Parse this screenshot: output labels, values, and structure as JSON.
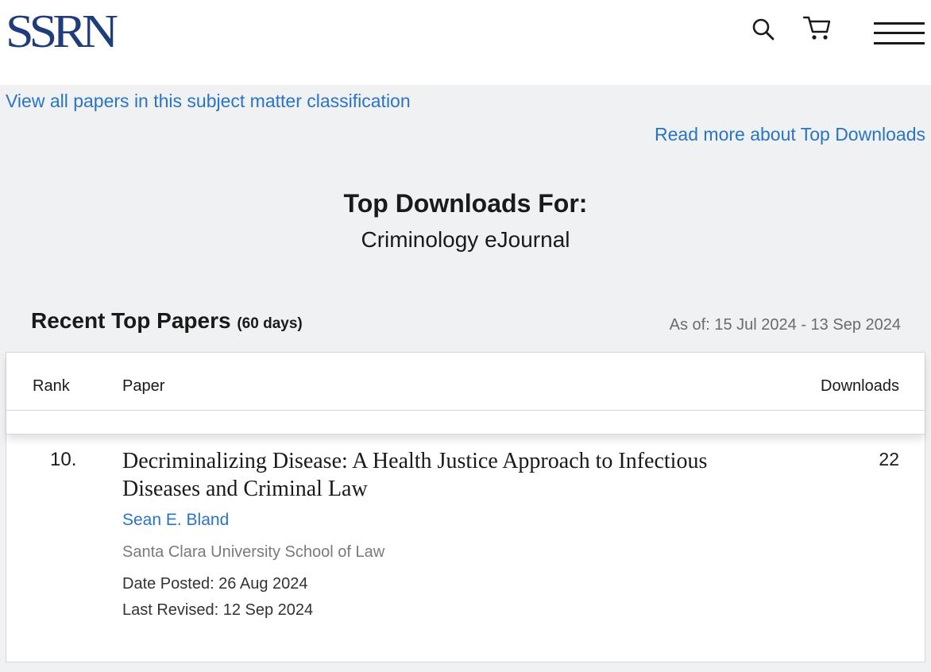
{
  "header": {
    "logo_text": "SSRN",
    "icons": {
      "search": "search-icon",
      "cart": "cart-icon",
      "menu": "hamburger-menu-icon"
    }
  },
  "links": {
    "view_all": "View all papers in this subject matter classification",
    "read_more": "Read more about Top Downloads"
  },
  "page": {
    "title": "Top Downloads For:",
    "subtitle": "Criminology eJournal"
  },
  "recent": {
    "heading": "Recent Top Papers",
    "period": "(60 days)",
    "as_of_label": "As of:",
    "as_of_range": "15 Jul 2024 - 13 Sep 2024"
  },
  "table": {
    "columns": {
      "rank": "Rank",
      "paper": "Paper",
      "downloads": "Downloads"
    },
    "rows": [
      {
        "rank": "10.",
        "title": "Decriminalizing Disease: A Health Justice Approach to Infectious Diseases and Criminal Law",
        "author": "Sean E. Bland",
        "affiliation": "Santa Clara University School of Law",
        "date_posted": "Date Posted: 26 Aug 2024",
        "last_revised": "Last Revised: 12 Sep 2024",
        "downloads": "22"
      }
    ]
  }
}
